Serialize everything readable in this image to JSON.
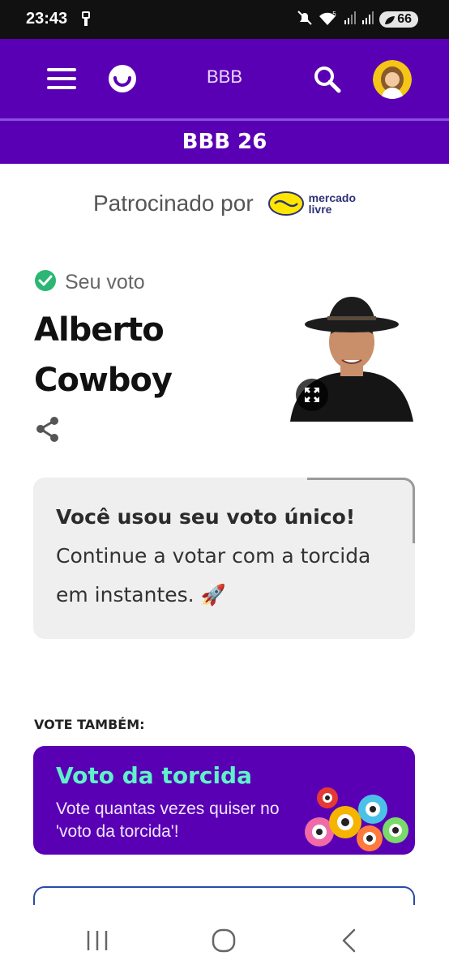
{
  "status_bar": {
    "time": "23:43",
    "battery": "66",
    "icons": [
      "usb-icon",
      "mute-icon",
      "wifi-5g-icon",
      "signal-icon",
      "signal-icon",
      "battery-icon"
    ]
  },
  "header": {
    "title": "BBB",
    "menu_icon": "hamburger-menu-icon",
    "logo_icon": "smile-logo-icon",
    "search_icon": "search-icon",
    "avatar_icon": "user-avatar-icon"
  },
  "subheader": {
    "title": "BBB 26"
  },
  "sponsor": {
    "label": "Patrocinado por",
    "brand_line1": "mercado",
    "brand_line2": "livre"
  },
  "vote": {
    "status_label": "Seu voto",
    "candidate_name": "Alberto Cowboy",
    "share_icon": "share-icon",
    "expand_icon": "expand-icon"
  },
  "info_card": {
    "headline": "Você usou seu voto único!",
    "body": "Continue a votar com a torcida em instantes. 🚀"
  },
  "vote_also": {
    "title": "VOTE TAMBÉM:",
    "torcida_title": "Voto da torcida",
    "torcida_desc": "Vote quantas vezes quiser no 'voto da torcida'!"
  },
  "colors": {
    "brand_purple": "#5a00b4",
    "accent_mint": "#5ff2c9",
    "check_green": "#2bb673",
    "card_gray": "#efefef"
  },
  "nav_bar": [
    "recent-apps-icon",
    "home-icon",
    "back-icon"
  ]
}
